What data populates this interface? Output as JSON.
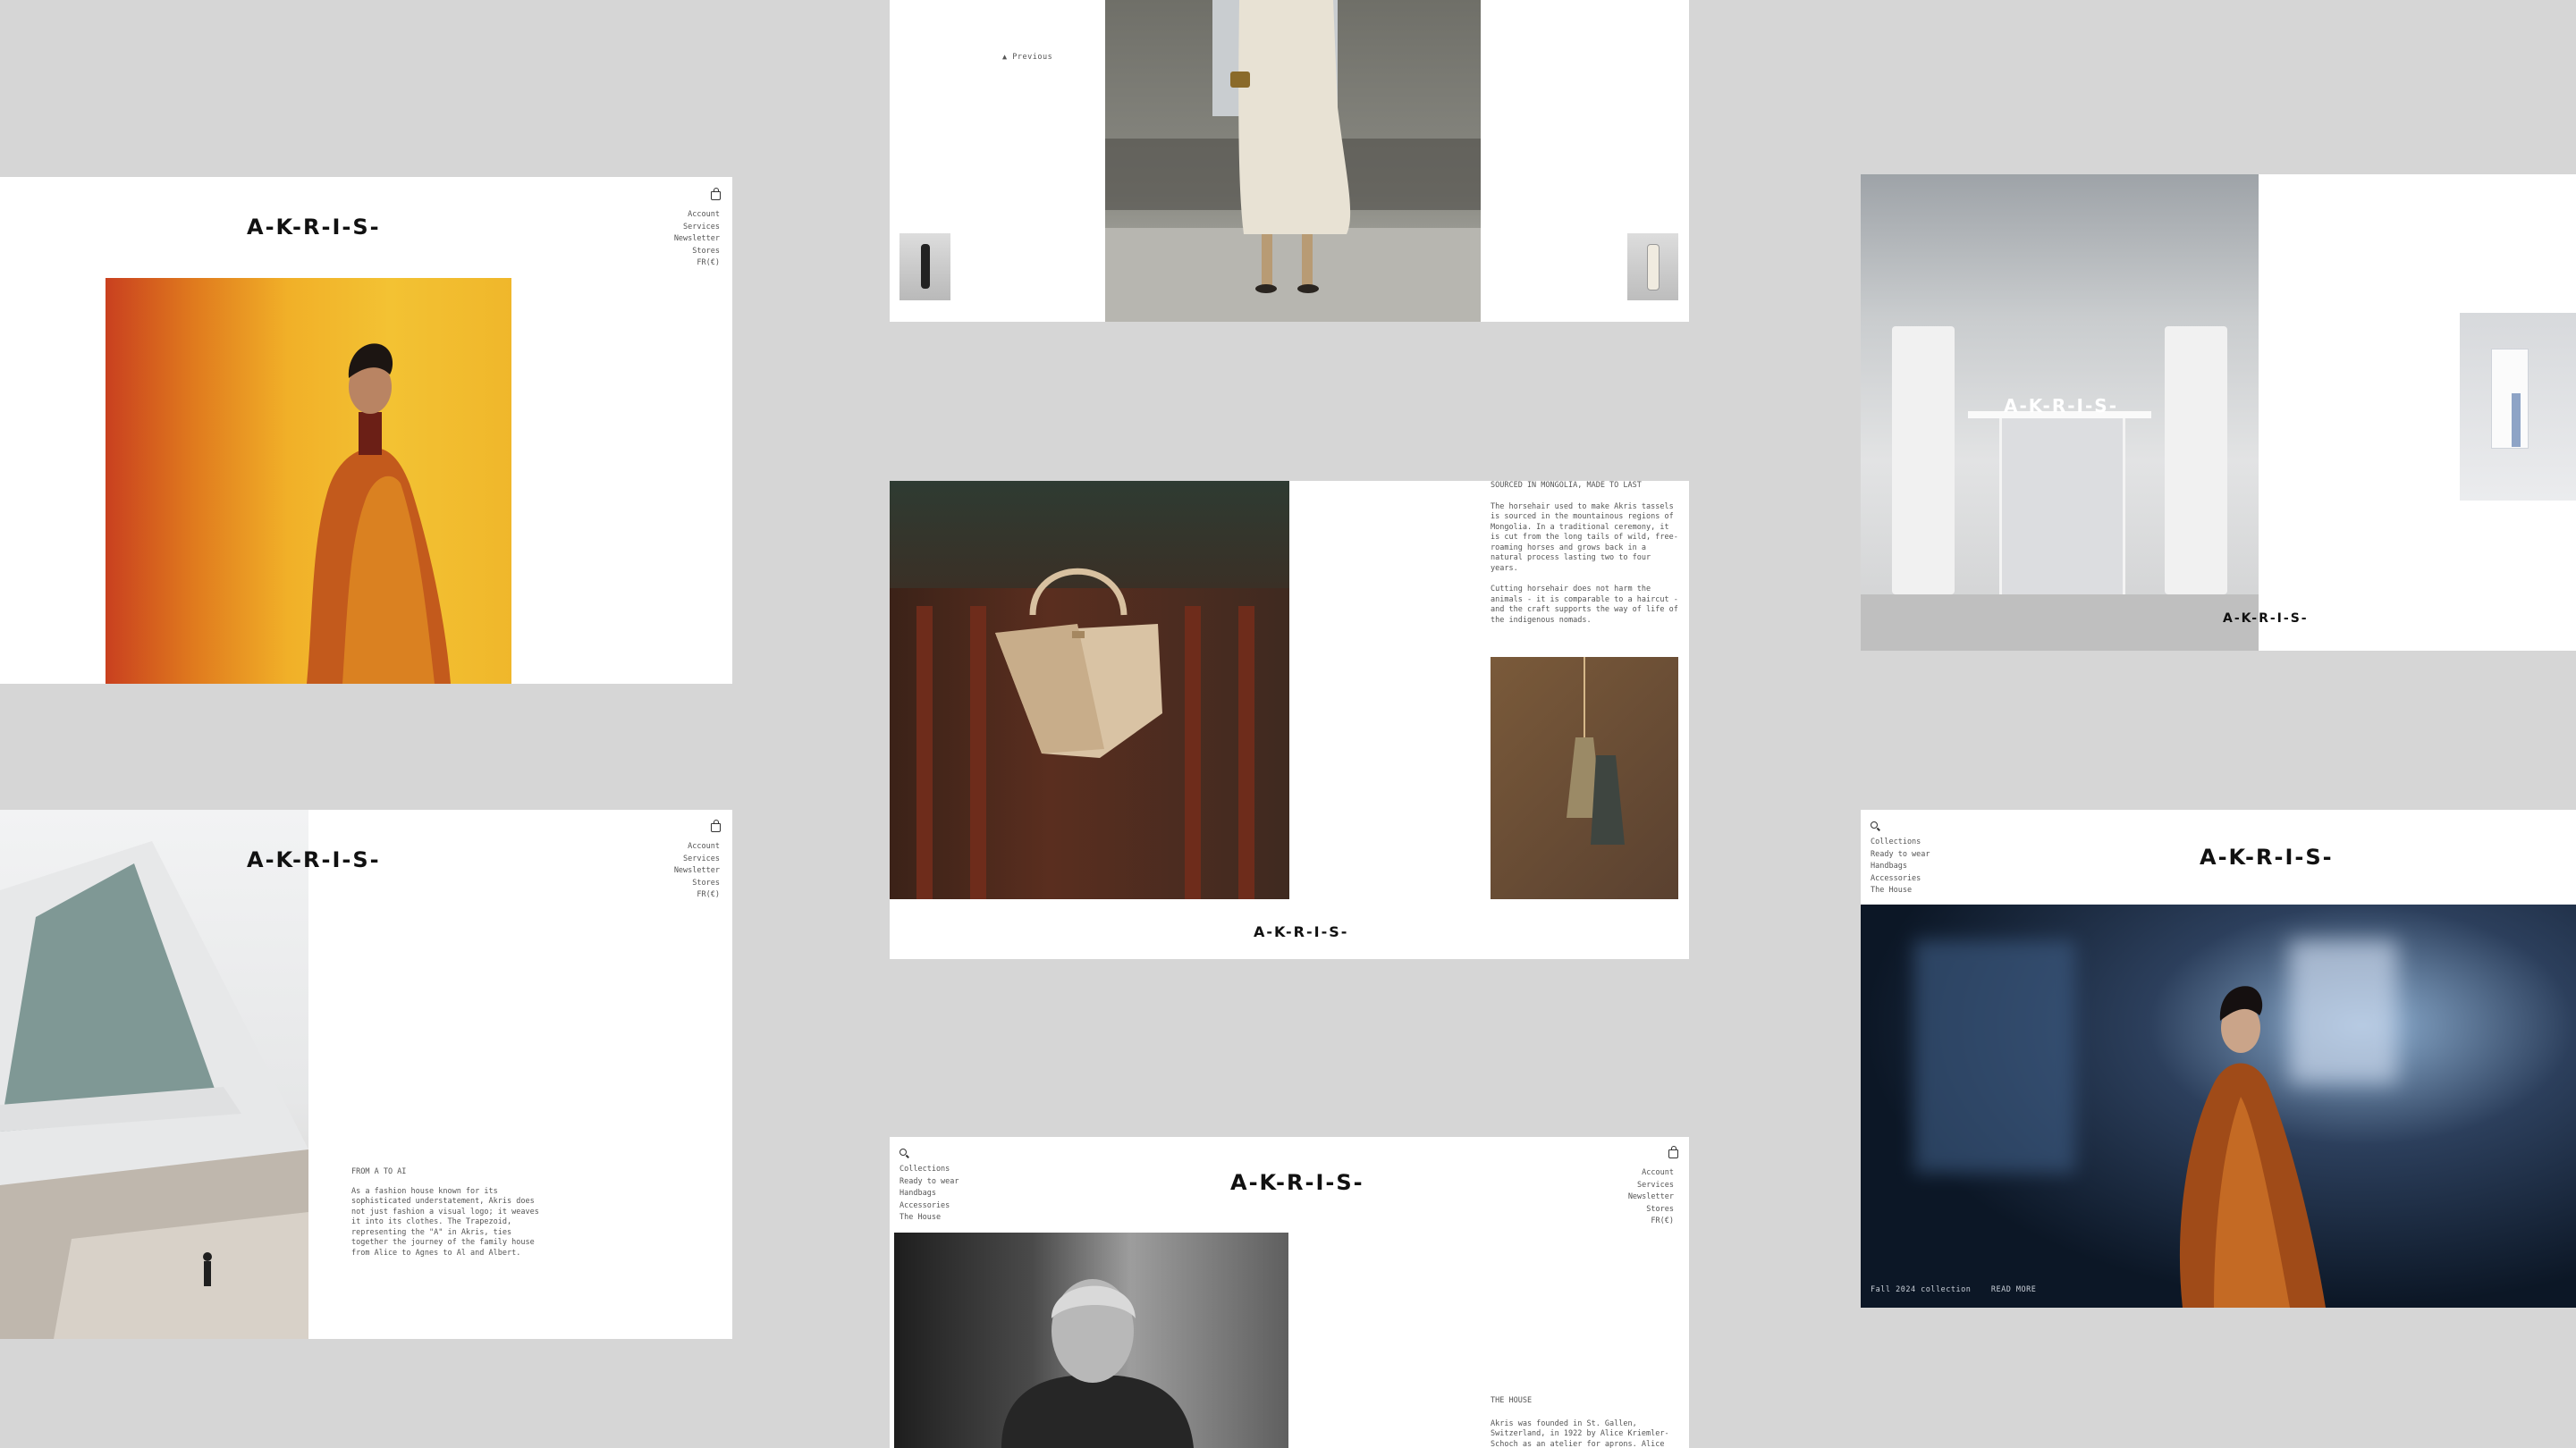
{
  "brand": {
    "logo": "A-K-R-I-S-"
  },
  "menu_right": {
    "account": "Account",
    "services": "Services",
    "newsletter": "Newsletter",
    "stores": "Stores",
    "locale": "FR(€)"
  },
  "menu_left": {
    "collections": "Collections",
    "ready_to_wear": "Ready to wear",
    "handbags": "Handbags",
    "accessories": "Accessories",
    "the_house": "The House"
  },
  "runway": {
    "previous_label": "Previous"
  },
  "horsehair": {
    "title": "SOURCED IN MONGOLIA, MADE TO LAST",
    "paragraph1": "The horsehair used to make Akris tassels is sourced in the mountainous regions of Mongolia. In a traditional ceremony, it is cut from the long tails of wild, free-roaming horses and grows back in a natural process lasting two to four years.",
    "paragraph2": "Cutting horsehair does not harm the animals - it is comparable to a haircut - and the craft supports the way of life of the indigenous nomads."
  },
  "trapezoid": {
    "title": "FROM A TO AI",
    "paragraph": "As a fashion house known for its sophisticated understatement, Akris does not just fashion a visual logo; it weaves it into its clothes. The Trapezoid, representing the \"A\" in Akris, ties together the journey of the family house from Alice to Agnes to Al and Albert."
  },
  "house": {
    "title": "THE HOUSE",
    "paragraph": "Akris was founded in St. Gallen, Switzerland, in 1922 by Alice Kriemler-Schoch as an atelier for aprons. Alice soon dressed the region's"
  },
  "campaign": {
    "caption": "Fall 2024 collection",
    "cta": "READ MORE"
  },
  "colors": {
    "background": "#d6d6d6",
    "panel": "#ffffff",
    "text": "#333333",
    "logo": "#111111"
  }
}
